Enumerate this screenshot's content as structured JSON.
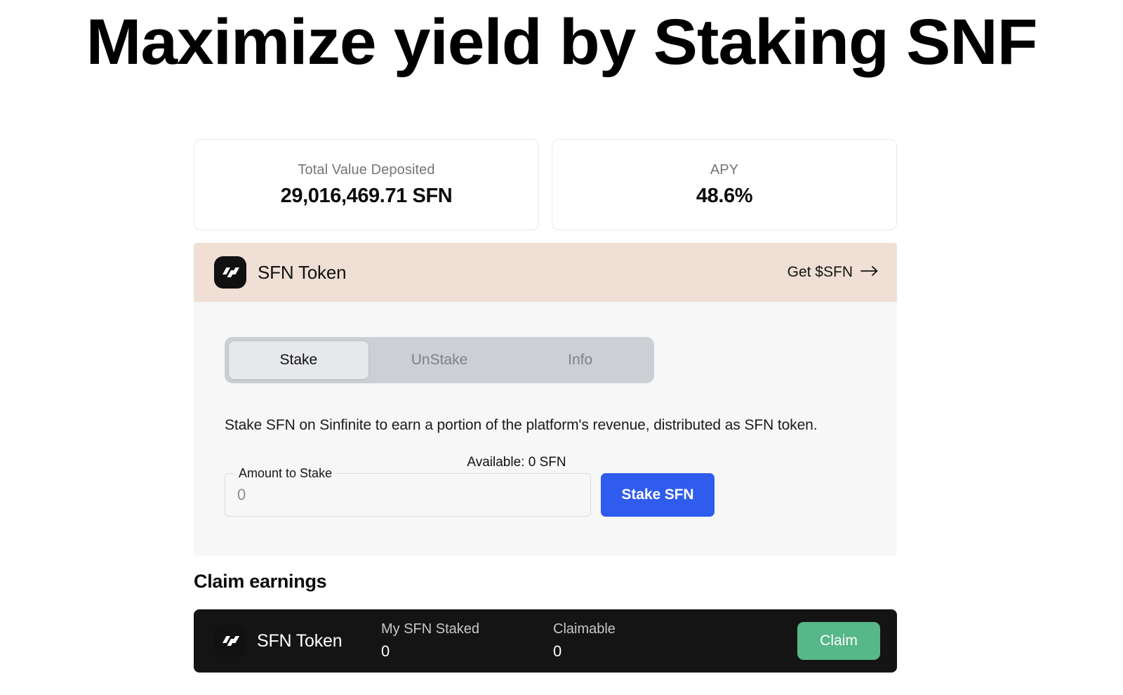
{
  "hero": {
    "title": "Maximize yield by Staking SNF"
  },
  "stats": [
    {
      "label": "Total Value Deposited",
      "value": "29,016,469.71 SFN"
    },
    {
      "label": "APY",
      "value": "48.6%"
    }
  ],
  "token_panel": {
    "token_name": "SFN Token",
    "get_token_label": "Get $SFN",
    "tabs": [
      {
        "label": "Stake",
        "active": true
      },
      {
        "label": "UnStake",
        "active": false
      },
      {
        "label": "Info",
        "active": false
      }
    ],
    "description": "Stake SFN on Sinfinite to earn a portion of the platform's revenue, distributed as SFN token.",
    "available_text": "Available: 0 SFN",
    "amount_field": {
      "label": "Amount to Stake",
      "placeholder": "0",
      "value": ""
    },
    "stake_button_label": "Stake SFN"
  },
  "claim_section": {
    "heading": "Claim earnings",
    "token_name": "SFN Token",
    "my_staked_label": "My SFN Staked",
    "my_staked_value": "0",
    "claimable_label": "Claimable",
    "claimable_value": "0",
    "claim_button_label": "Claim"
  },
  "colors": {
    "page_background": "#ffffff",
    "panel_header": "#efdfd4",
    "panel_body": "#f7f7f7",
    "tab_track": "#ccd0d4",
    "tab_active": "#e6e8ea",
    "stake_button": "#2f5ced",
    "claim_card": "#141414",
    "claim_button": "#56b789",
    "logo_background": "#111111"
  }
}
